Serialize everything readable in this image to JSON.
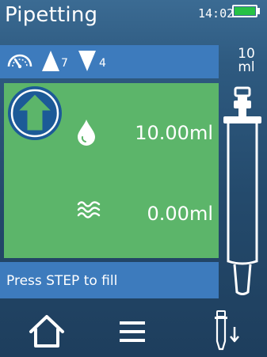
{
  "status": {
    "title": "Pipetting",
    "time": "14:02",
    "battery_color": "#27c146"
  },
  "speed": {
    "icon": "gauge-icon",
    "aspirate_speed": "7",
    "dispense_speed": "4"
  },
  "syringe": {
    "volume_value": "10",
    "volume_unit": "ml"
  },
  "panel": {
    "background": "#5cb56a",
    "target_volume": "10.00ml",
    "current_volume": "0.00ml"
  },
  "prompt": {
    "text": "Press STEP to fill"
  },
  "toolbar": {
    "home_icon": "home-icon",
    "menu_icon": "menu-icon",
    "pipette_icon": "pipette-dispense-icon"
  },
  "colors": {
    "accent_blue": "#3d7bbd",
    "icon_blue": "#1c5a97"
  }
}
